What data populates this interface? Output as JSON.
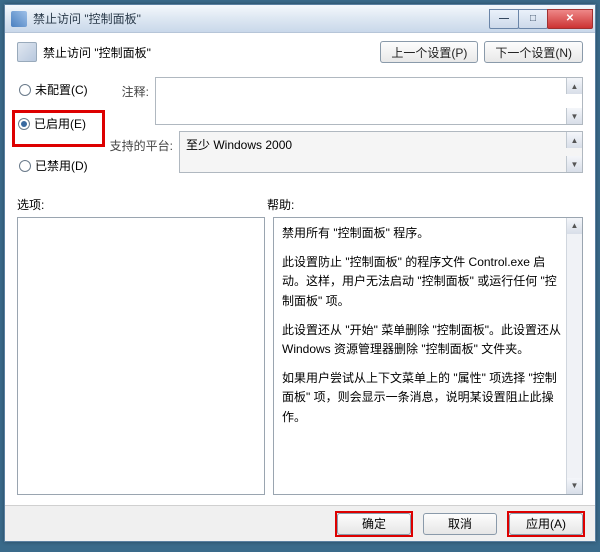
{
  "title": "禁止访问 \"控制面板\"",
  "window_controls": {
    "min": "—",
    "max": "□",
    "close": "✕"
  },
  "header_title": "禁止访问 \"控制面板\"",
  "nav": {
    "prev": "上一个设置(P)",
    "next": "下一个设置(N)"
  },
  "radios": {
    "not_configured": "未配置(C)",
    "enabled": "已启用(E)",
    "disabled": "已禁用(D)"
  },
  "labels": {
    "comment": "注释:",
    "platform": "支持的平台:",
    "options": "选项:",
    "help": "帮助:"
  },
  "platform_text": "至少 Windows 2000",
  "help": {
    "p1": "禁用所有 \"控制面板\" 程序。",
    "p2": "此设置防止 \"控制面板\" 的程序文件 Control.exe 启动。这样，用户无法启动 \"控制面板\" 或运行任何 \"控制面板\" 项。",
    "p3": "此设置还从 \"开始\" 菜单删除 \"控制面板\"。此设置还从 Windows 资源管理器删除 \"控制面板\" 文件夹。",
    "p4": "如果用户尝试从上下文菜单上的 \"属性\" 项选择 \"控制面板\" 项，则会显示一条消息，说明某设置阻止此操作。"
  },
  "footer": {
    "ok": "确定",
    "cancel": "取消",
    "apply": "应用(A)"
  }
}
